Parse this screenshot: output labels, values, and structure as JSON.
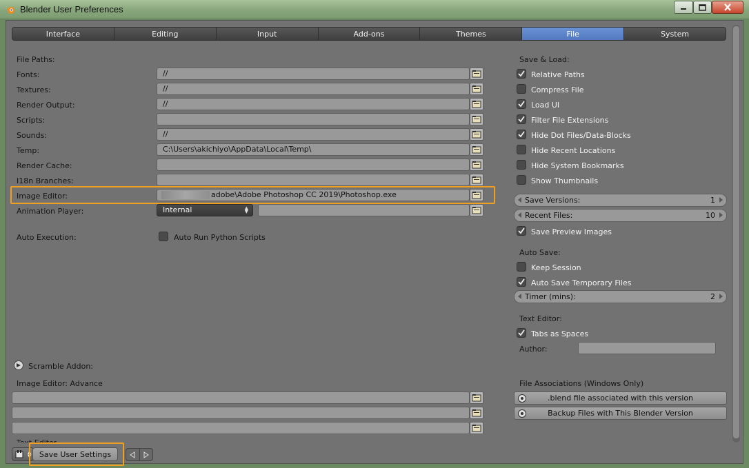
{
  "window": {
    "title": "Blender User Preferences",
    "minimize_icon": "minimize-icon",
    "maximize_icon": "maximize-icon",
    "close_icon": "close-icon"
  },
  "tabs": [
    {
      "label": "Interface",
      "active": false
    },
    {
      "label": "Editing",
      "active": false
    },
    {
      "label": "Input",
      "active": false
    },
    {
      "label": "Add-ons",
      "active": false
    },
    {
      "label": "Themes",
      "active": false
    },
    {
      "label": "File",
      "active": true
    },
    {
      "label": "System",
      "active": false
    }
  ],
  "file_paths": {
    "heading": "File Paths:",
    "rows": [
      {
        "label": "Fonts:",
        "value": "//"
      },
      {
        "label": "Textures:",
        "value": "//"
      },
      {
        "label": "Render Output:",
        "value": "//"
      },
      {
        "label": "Scripts:",
        "value": ""
      },
      {
        "label": "Sounds:",
        "value": "//"
      },
      {
        "label": "Temp:",
        "value": "C:\\Users\\akichiyo\\AppData\\Local\\Temp\\"
      },
      {
        "label": "Render Cache:",
        "value": ""
      },
      {
        "label": "I18n Branches:",
        "value": ""
      },
      {
        "label": "Image Editor:",
        "value": "adobe\\Adobe Photoshop CC 2019\\Photoshop.exe"
      }
    ],
    "animation_player": {
      "label": "Animation Player:",
      "selected": "Internal",
      "value": ""
    }
  },
  "auto_execution": {
    "label": "Auto Execution:",
    "checkbox_label": "Auto Run Python Scripts",
    "checked": false
  },
  "addons": {
    "scramble_label": "Scramble Addon:",
    "image_editor_advance_label": "Image Editor: Advance",
    "fields": [
      "",
      "",
      ""
    ],
    "cut_off_label": "Text Editor"
  },
  "save_load": {
    "heading": "Save & Load:",
    "options": [
      {
        "label": "Relative Paths",
        "checked": true
      },
      {
        "label": "Compress File",
        "checked": false
      },
      {
        "label": "Load UI",
        "checked": true
      },
      {
        "label": "Filter File Extensions",
        "checked": true
      },
      {
        "label": "Hide Dot Files/Data-Blocks",
        "checked": true
      },
      {
        "label": "Hide Recent Locations",
        "checked": false
      },
      {
        "label": "Hide System Bookmarks",
        "checked": false
      },
      {
        "label": "Show Thumbnails",
        "checked": false
      }
    ],
    "save_versions": {
      "label": "Save Versions:",
      "value": "1"
    },
    "recent_files": {
      "label": "Recent Files:",
      "value": "10"
    },
    "save_preview": {
      "label": "Save Preview Images",
      "checked": true
    }
  },
  "auto_save": {
    "heading": "Auto Save:",
    "keep_session": {
      "label": "Keep Session",
      "checked": false
    },
    "auto_save_temp": {
      "label": "Auto Save Temporary Files",
      "checked": true
    },
    "timer": {
      "label": "Timer (mins):",
      "value": "2"
    }
  },
  "text_editor": {
    "heading": "Text Editor:",
    "tabs_as_spaces": {
      "label": "Tabs as Spaces",
      "checked": true
    },
    "author_label": "Author:",
    "author_value": ""
  },
  "file_associations": {
    "heading": "File Associations (Windows Only)",
    "associate_label": ".blend file associated with this version",
    "backup_label": "Backup Files with This Blender Version"
  },
  "bottom": {
    "save_button": "Save User Settings"
  }
}
